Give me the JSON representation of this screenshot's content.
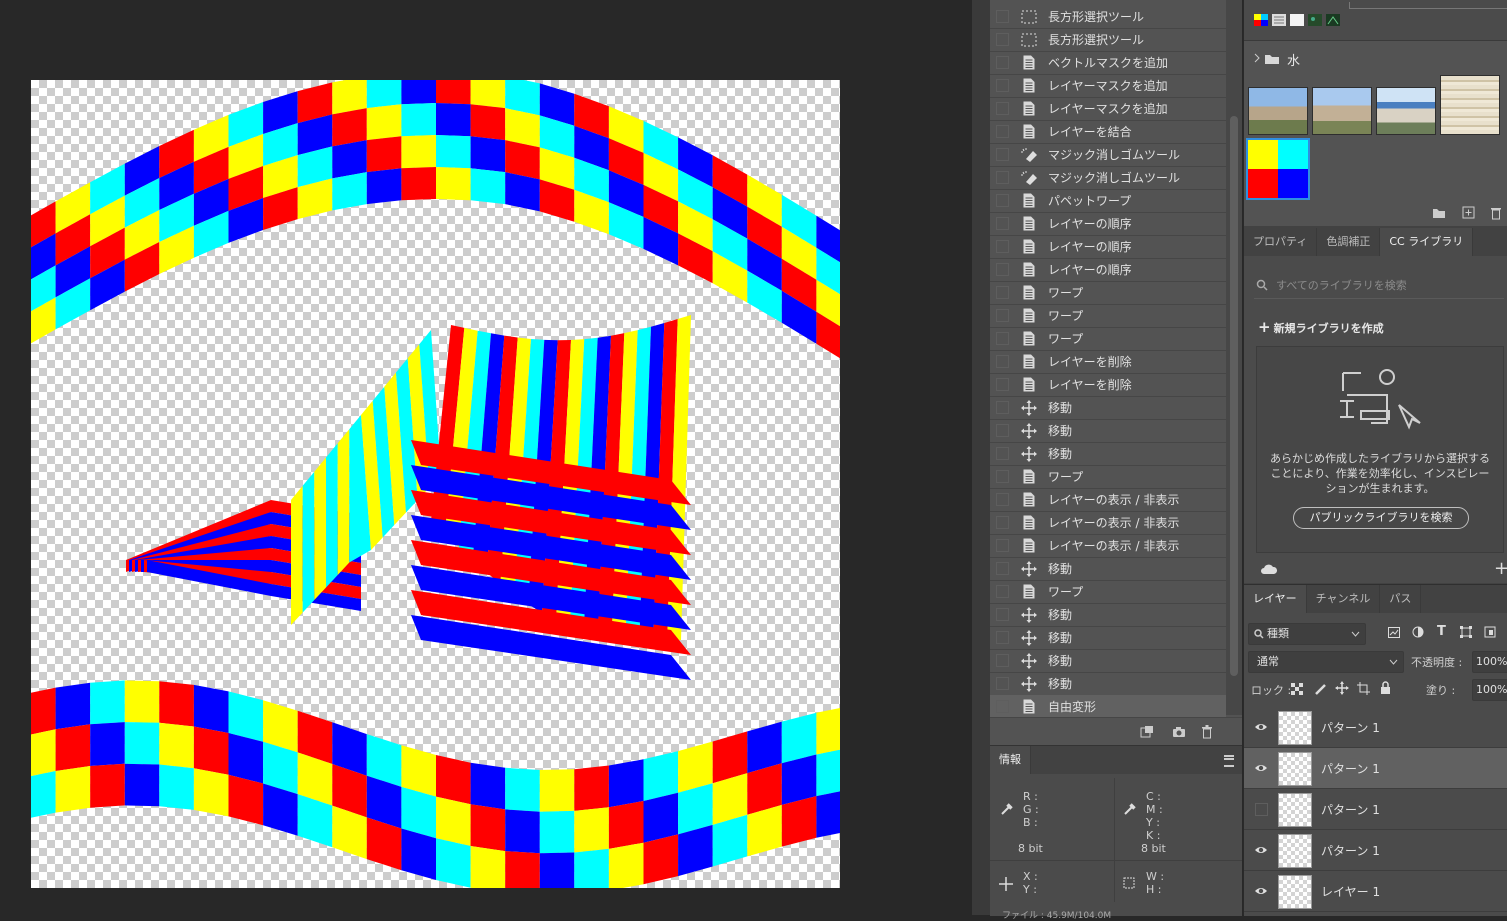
{
  "history": {
    "items": [
      {
        "label": "長方形選択ツール",
        "icon": "rect-select-icon"
      },
      {
        "label": "長方形選択ツール",
        "icon": "rect-select-icon"
      },
      {
        "label": "ベクトルマスクを追加",
        "icon": "document-icon"
      },
      {
        "label": "レイヤーマスクを追加",
        "icon": "document-icon"
      },
      {
        "label": "レイヤーマスクを追加",
        "icon": "document-icon"
      },
      {
        "label": "レイヤーを結合",
        "icon": "document-icon"
      },
      {
        "label": "マジック消しゴムツール",
        "icon": "magic-eraser-icon"
      },
      {
        "label": "マジック消しゴムツール",
        "icon": "magic-eraser-icon"
      },
      {
        "label": "パペットワープ",
        "icon": "document-icon"
      },
      {
        "label": "レイヤーの順序",
        "icon": "document-icon"
      },
      {
        "label": "レイヤーの順序",
        "icon": "document-icon"
      },
      {
        "label": "レイヤーの順序",
        "icon": "document-icon"
      },
      {
        "label": "ワープ",
        "icon": "document-icon"
      },
      {
        "label": "ワープ",
        "icon": "document-icon"
      },
      {
        "label": "ワープ",
        "icon": "document-icon"
      },
      {
        "label": "レイヤーを削除",
        "icon": "document-icon"
      },
      {
        "label": "レイヤーを削除",
        "icon": "document-icon"
      },
      {
        "label": "移動",
        "icon": "move-icon"
      },
      {
        "label": "移動",
        "icon": "move-icon"
      },
      {
        "label": "移動",
        "icon": "move-icon"
      },
      {
        "label": "ワープ",
        "icon": "document-icon"
      },
      {
        "label": "レイヤーの表示 / 非表示",
        "icon": "document-icon"
      },
      {
        "label": "レイヤーの表示 / 非表示",
        "icon": "document-icon"
      },
      {
        "label": "レイヤーの表示 / 非表示",
        "icon": "document-icon"
      },
      {
        "label": "移動",
        "icon": "move-icon"
      },
      {
        "label": "ワープ",
        "icon": "document-icon"
      },
      {
        "label": "移動",
        "icon": "move-icon"
      },
      {
        "label": "移動",
        "icon": "move-icon"
      },
      {
        "label": "移動",
        "icon": "move-icon"
      },
      {
        "label": "移動",
        "icon": "move-icon"
      },
      {
        "label": "自由変形",
        "icon": "document-icon"
      }
    ]
  },
  "info": {
    "tab": "情報",
    "rgb_labels": [
      "R :",
      "G :",
      "B :"
    ],
    "cmyk_labels": [
      "C :",
      "M :",
      "Y :",
      "K :"
    ],
    "bitdepth_left": "8 bit",
    "bitdepth_right": "8 bit",
    "xy_labels": [
      "X :",
      "Y :"
    ],
    "wh_labels": [
      "W :",
      "H :"
    ],
    "file_line": "ファイル : 45.9M/104.0M"
  },
  "libraries": {
    "folder_name": "水",
    "tabs": [
      "プロパティ",
      "色調補正",
      "CC ライブラリ"
    ],
    "search_placeholder": "すべてのライブラリを検索",
    "new_library": "新規ライブラリを作成",
    "empty_text": "あらかじめ作成したライブラリから選択することにより、作業を効率化し、インスピレーションが生まれます。",
    "public_button": "パブリックライブラリを検索"
  },
  "layers": {
    "tabs": [
      "レイヤー",
      "チャンネル",
      "パス"
    ],
    "filter_label": "種類",
    "blend_mode": "通常",
    "opacity_label": "不透明度 :",
    "opacity_value": "100%",
    "lock_label": "ロック :",
    "fill_label": "塗り :",
    "fill_value": "100%",
    "items": [
      {
        "name": "パターン 1",
        "visible": true
      },
      {
        "name": "パターン 1",
        "visible": true
      },
      {
        "name": "パターン 1",
        "visible": false
      },
      {
        "name": "パターン 1",
        "visible": true
      },
      {
        "name": "レイヤー 1",
        "visible": true
      }
    ]
  },
  "colors": {
    "red": "#ff0000",
    "yellow": "#ffff00",
    "cyan": "#00ffff",
    "blue": "#0000ff"
  }
}
